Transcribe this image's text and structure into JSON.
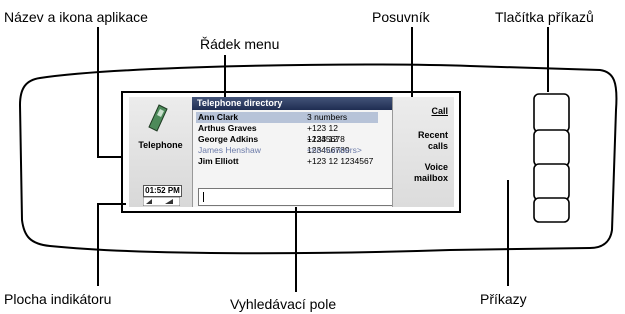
{
  "callouts": {
    "app_name_icon": "Název a ikona aplikace",
    "menu_line": "Řádek menu",
    "scrollbar": "Posuvník",
    "command_buttons": "Tlačítka příkazů",
    "indicator_area": "Plocha indikátoru",
    "search_field": "Vyhledávací pole",
    "commands": "Příkazy"
  },
  "screen": {
    "app_name": "Telephone",
    "clock": "01:52 PM",
    "title": "Telephone directory",
    "contacts": [
      {
        "name": "Ann Clark",
        "number": "3 numbers"
      },
      {
        "name": "Arthus Graves",
        "number": "+123 12 12345678"
      },
      {
        "name": "George Adkins",
        "number": "+123 12 123456789"
      },
      {
        "name": "James Henshaw",
        "number": "<no numbers>"
      },
      {
        "name": "Jim Elliott",
        "number": "+123 12 1234567"
      }
    ],
    "commands": [
      "Call",
      "Recent calls",
      "Voice mailbox"
    ]
  }
}
